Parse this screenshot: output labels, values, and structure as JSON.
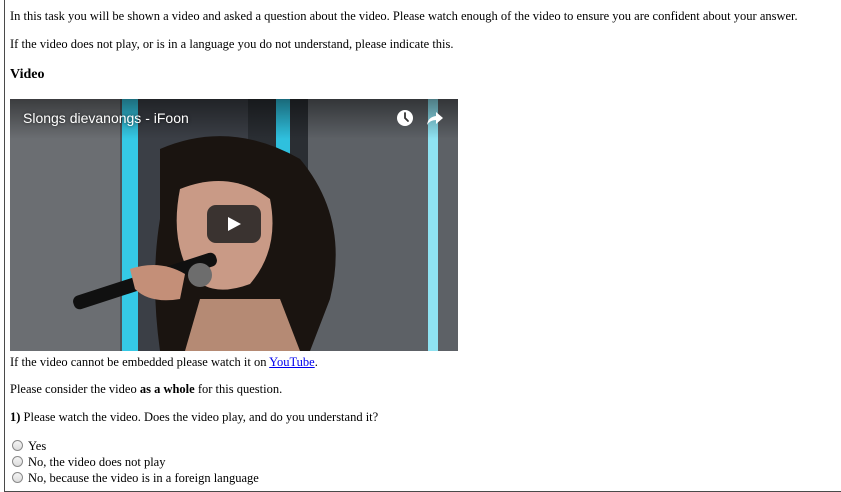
{
  "intro": {
    "line1": "In this task you will be shown a video and asked a question about the video. Please watch enough of the video to ensure you are confident about your answer.",
    "line2": "If the video does not play, or is in a language you do not understand, please indicate this."
  },
  "section_title": "Video",
  "video": {
    "title": "Slongs dievanongs - iFoon",
    "icons": [
      "clock-icon",
      "share-icon",
      "play-icon"
    ]
  },
  "embed_note": {
    "prefix": "If the video cannot be embedded please watch it on ",
    "link": "YouTube",
    "suffix": "."
  },
  "consider": {
    "prefix": "Please consider the video ",
    "bold": "as a whole",
    "suffix": " for this question."
  },
  "question": {
    "number": "1)",
    "text": " Please watch the video. Does the video play, and do you understand it?",
    "options": [
      "Yes",
      "No, the video does not play",
      "No, because the video is in a foreign language"
    ]
  }
}
